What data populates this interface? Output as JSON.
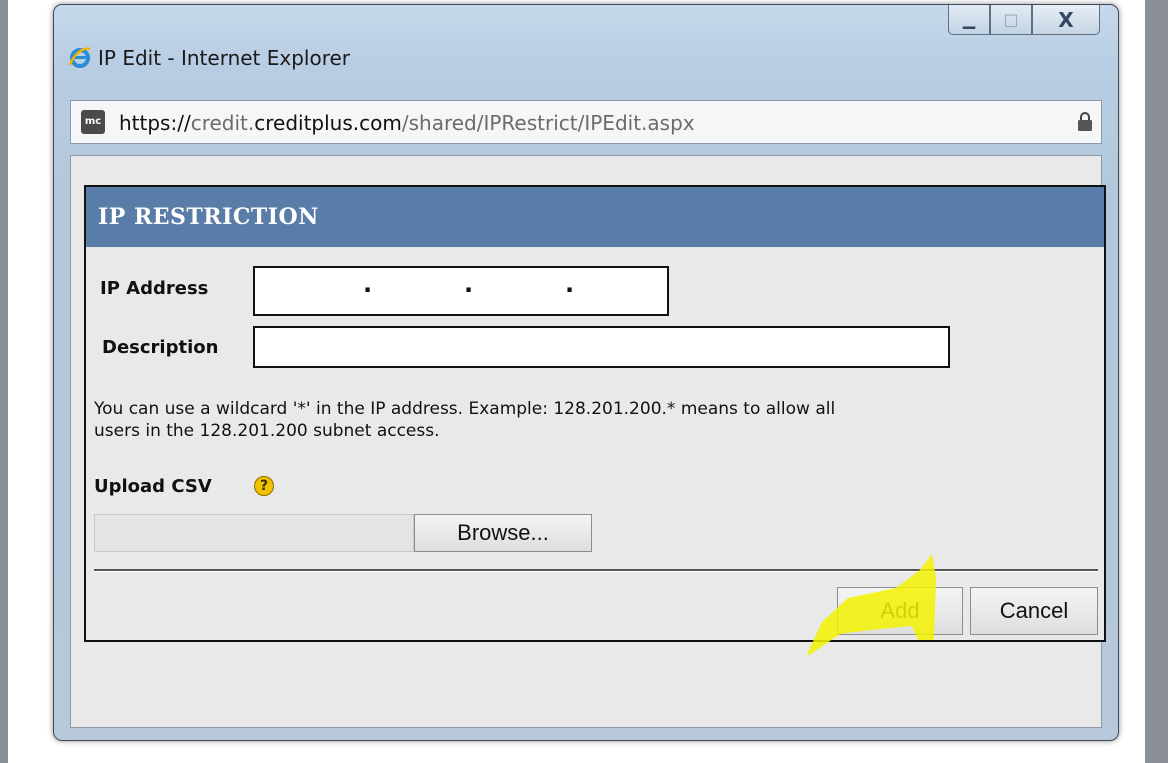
{
  "window": {
    "title": "IP Edit - Internet Explorer",
    "controls": {
      "minimize": "▁",
      "maximize": "□",
      "close": "X"
    }
  },
  "address_bar": {
    "scheme": "https://",
    "subdomain": "credit.",
    "domain": "creditplus.com",
    "path": "/shared/IPRestrict/IPEdit.aspx",
    "site_icon": "mc"
  },
  "panel": {
    "title": "IP RESTRICTION",
    "ip_label": "IP Address",
    "ip_dots": [
      ".",
      ".",
      "."
    ],
    "description_label": "Description",
    "description_value": "",
    "help_line1": "You can use a wildcard '*' in the IP address. Example: 128.201.200.* means to allow all",
    "help_line2": "users in the 128.201.200 subnet access.",
    "upload_label": "Upload CSV",
    "help_icon_glyph": "?",
    "browse_label": "Browse...",
    "add_label": "Add",
    "cancel_label": "Cancel"
  },
  "colors": {
    "header": "#5a7ca8",
    "highlight": "#f2f200"
  },
  "icons": [
    "ie-logo-icon",
    "site-favicon-icon",
    "lock-icon",
    "help-icon"
  ]
}
